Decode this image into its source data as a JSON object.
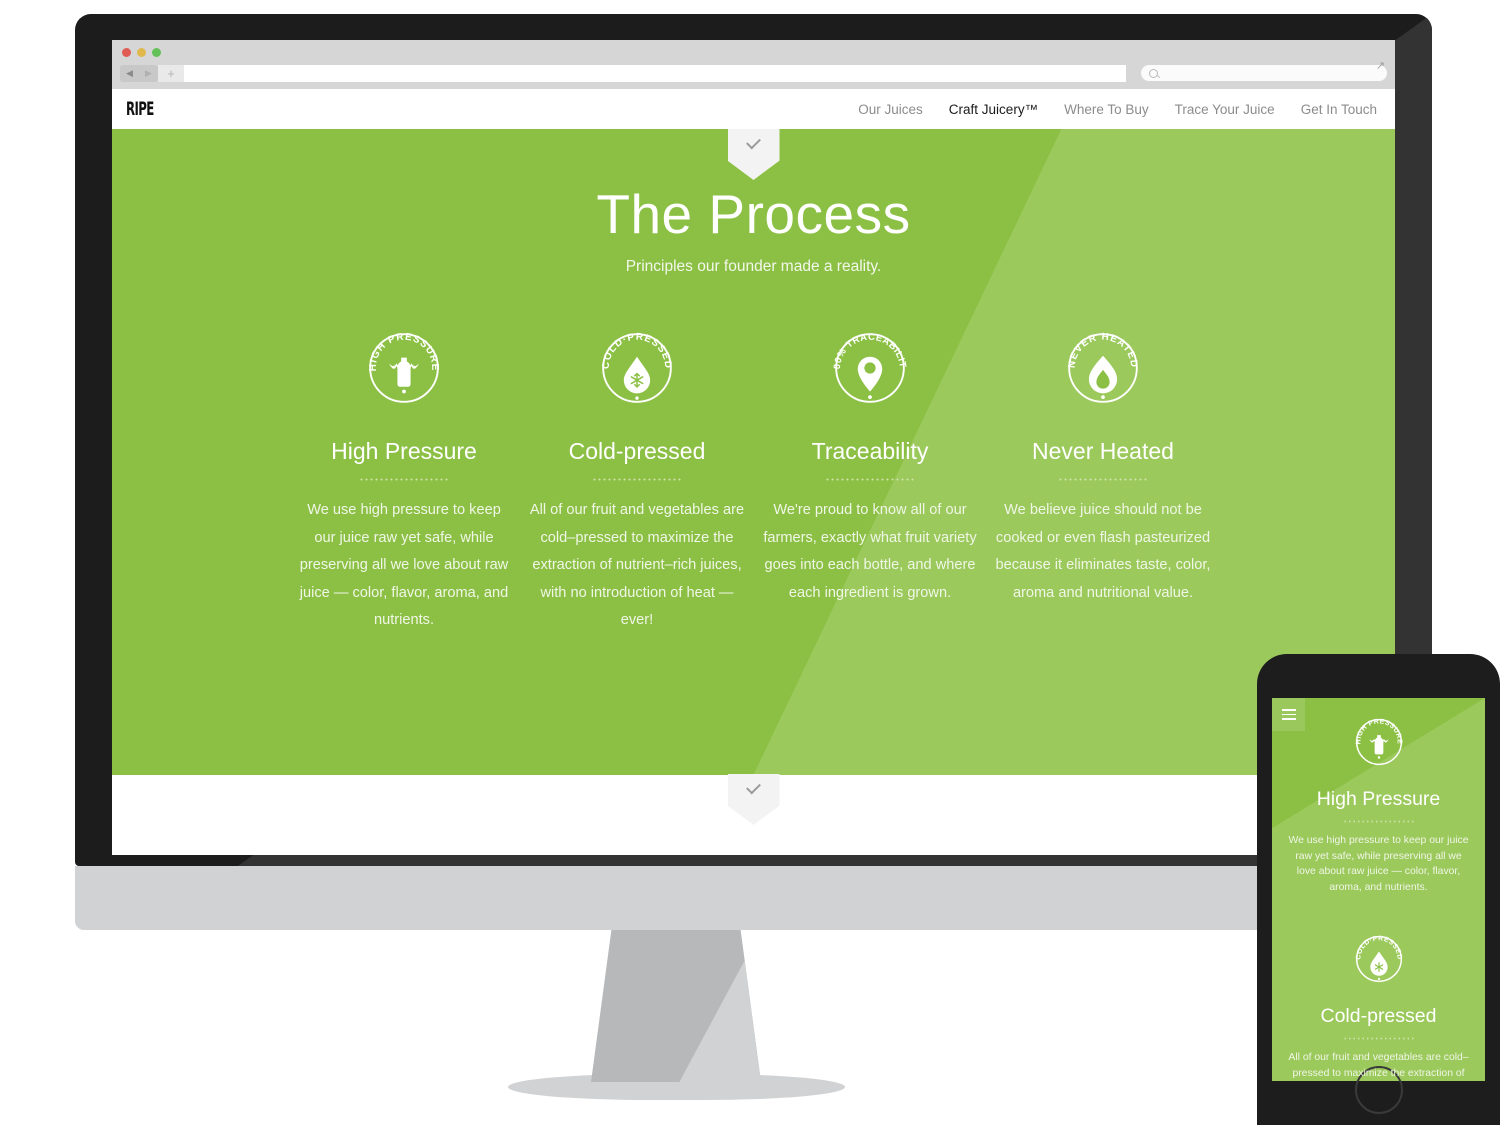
{
  "browser": {
    "back_icon": "back-arrow-icon",
    "forward_icon": "forward-arrow-icon",
    "new_tab_label": "+",
    "url_value": "",
    "url_placeholder": "",
    "search_placeholder": "",
    "search_icon": "search-icon",
    "expand_icon": "fullscreen-expand-icon"
  },
  "site": {
    "logo": "RIPE",
    "nav": [
      {
        "label": "Our Juices",
        "active": false
      },
      {
        "label": "Craft Juicery™",
        "active": true
      },
      {
        "label": "Where To Buy",
        "active": false
      },
      {
        "label": "Trace Your Juice",
        "active": false
      },
      {
        "label": "Get In Touch",
        "active": false
      }
    ]
  },
  "hero": {
    "title": "The Process",
    "subtitle": "Principles our founder made a reality.",
    "chevron_icon": "chevron-down-icon",
    "bg_color": "#8cc045",
    "bg_accent_color": "#9bc95c"
  },
  "columns": [
    {
      "badge_text": "HIGH PRESSURE",
      "badge_icon": "bottle-icon",
      "title": "High Pressure",
      "body": "We use high pressure to keep our juice raw yet safe, while preserving all we love about raw juice — color, flavor, aroma, and nutrients."
    },
    {
      "badge_text": "COLD·PRESSED",
      "badge_icon": "droplet-snowflake-icon",
      "title": "Cold-pressed",
      "body": "All of our fruit and vegetables are cold–pressed to maximize the extraction of nutrient–rich juices, with no introduction of heat — ever!"
    },
    {
      "badge_text": "100% TRACEABILITY",
      "badge_icon": "map-pin-icon",
      "title": "Traceability",
      "body": "We're proud to know all of our farmers, exactly what fruit variety goes into each bottle, and where each ingredient is grown."
    },
    {
      "badge_text": "NEVER HEATED",
      "badge_icon": "flame-icon",
      "title": "Never Heated",
      "body": "We believe juice should not be cooked or even flash pasteurized because it eliminates taste, color, aroma and nutritional value."
    }
  ],
  "phone": {
    "menu_icon": "hamburger-menu-icon",
    "home_button": "home-button",
    "sections": [
      {
        "badge_text": "HIGH PRESSURE",
        "badge_icon": "bottle-icon",
        "title": "High Pressure",
        "body": "We use high pressure to keep our juice raw yet safe, while preserving all we love about raw juice — color, flavor, aroma, and nutrients."
      },
      {
        "badge_text": "COLD·PRESSED",
        "badge_icon": "droplet-snowflake-icon",
        "title": "Cold-pressed",
        "body": "All of our fruit and vegetables are cold–pressed to maximize the extraction of nutrient–rich juices, with no introduction of heat — ever!"
      }
    ]
  }
}
